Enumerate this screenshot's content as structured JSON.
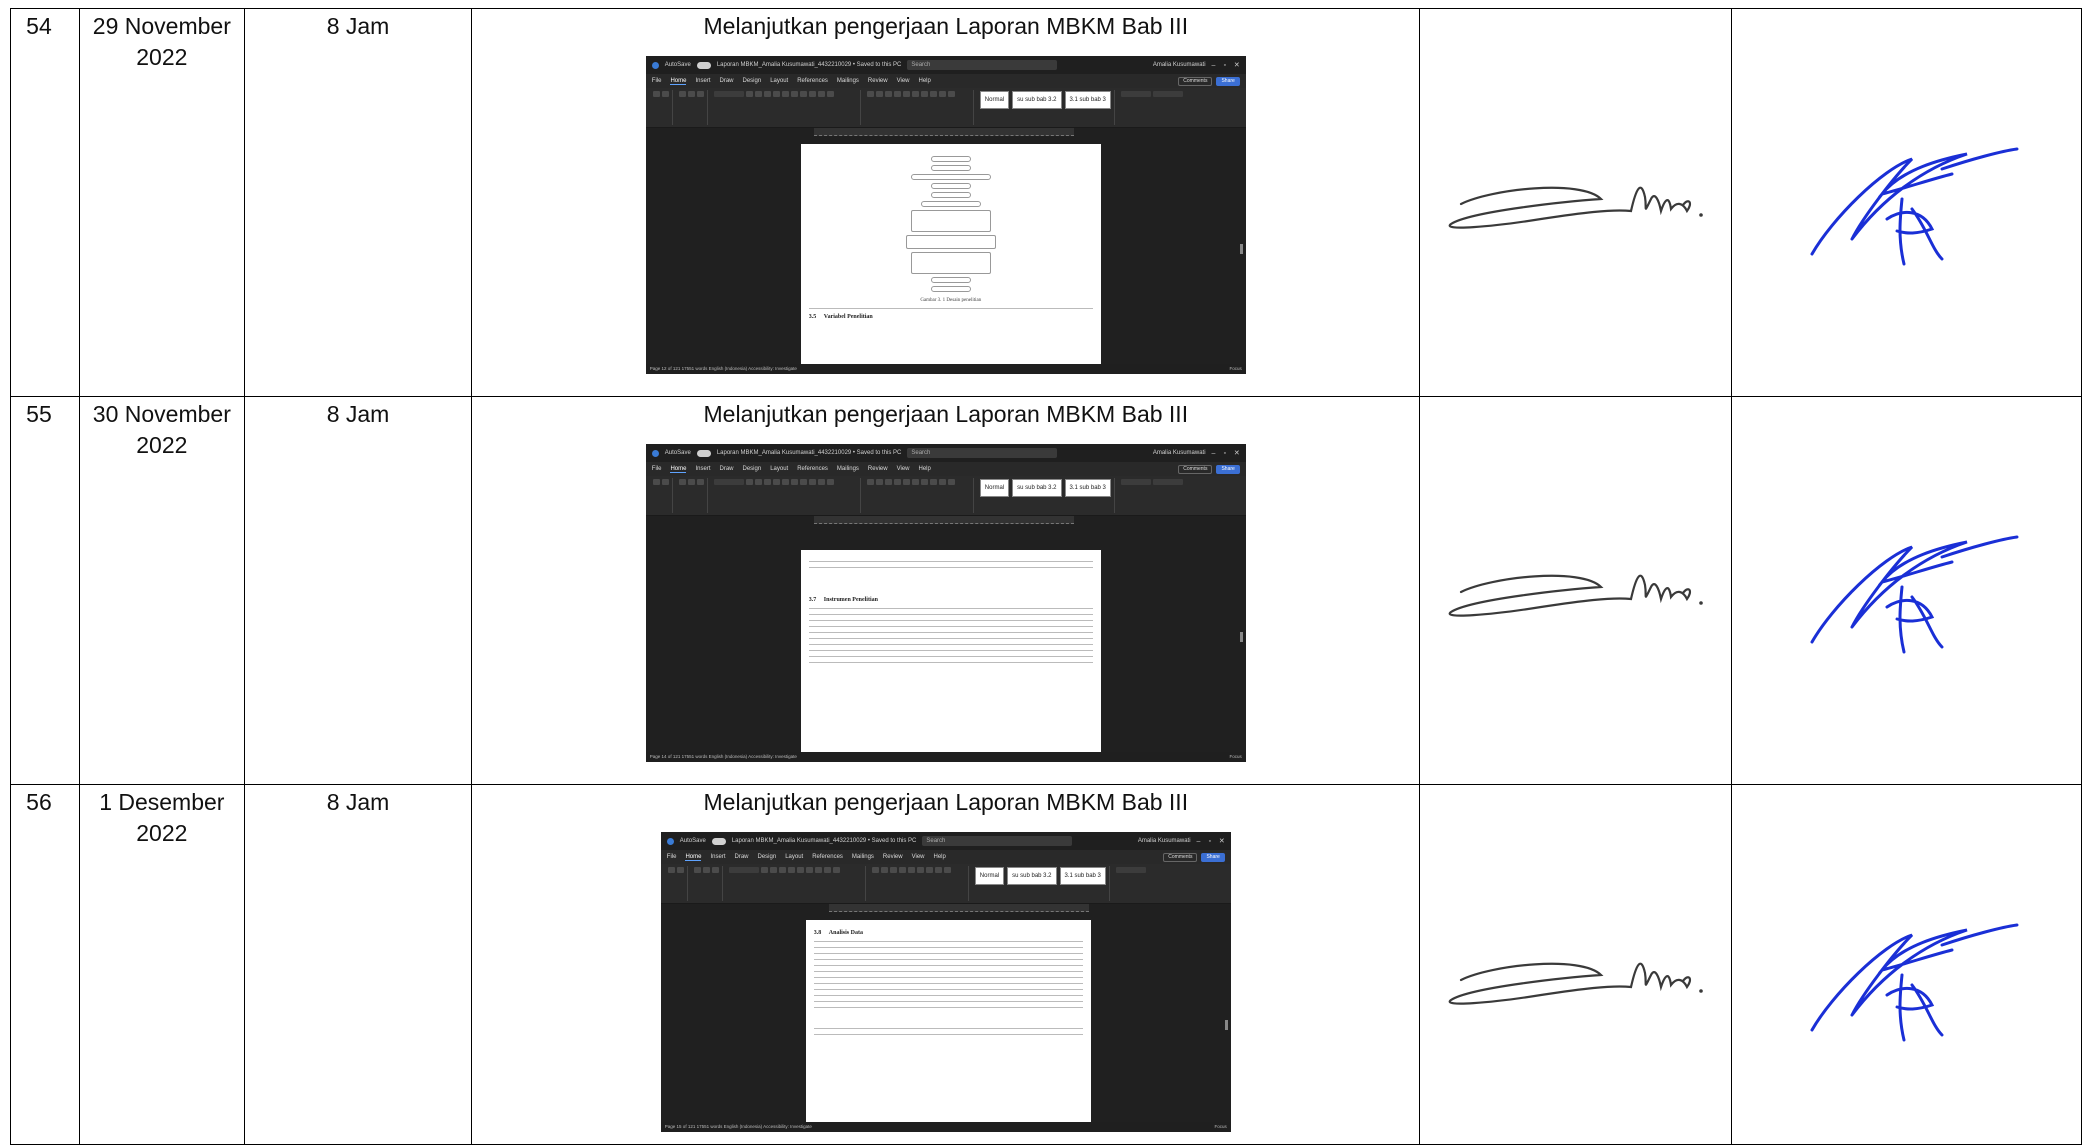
{
  "rows": [
    {
      "no": "54",
      "date": "29 November 2022",
      "duration": "8 Jam",
      "activity": "Melanjutkan pengerjaan Laporan MBKM Bab III",
      "screenshot": {
        "heading": "Variabel Penelitian",
        "section": "3.5",
        "caption": "Gambar 3. 1 Desain penelitian",
        "status": "Page 12 of 121   17551 words   English (Indonesia)   Accessibility: Investigate"
      }
    },
    {
      "no": "55",
      "date": "30 November 2022",
      "duration": "8 Jam",
      "activity": "Melanjutkan pengerjaan Laporan MBKM Bab III",
      "screenshot": {
        "heading": "Instrumen Penelitian",
        "section": "3.7",
        "caption": "",
        "status": "Page 14 of 121   17551 words   English (Indonesia)   Accessibility: Investigate"
      }
    },
    {
      "no": "56",
      "date": "1 Desember 2022",
      "duration": "8 Jam",
      "activity": "Melanjutkan pengerjaan Laporan MBKM Bab III",
      "screenshot": {
        "heading": "Analisis Data",
        "section": "3.8",
        "caption": "",
        "status": "Page 15 of 121   17551 words   English (Indonesia)   Accessibility: Investigate"
      }
    }
  ],
  "word_ui": {
    "autosave": "AutoSave",
    "doc_title": "Laporan MBKM_Amalia Kusumawati_4432210029 • Saved to this PC",
    "search": "Search",
    "user": "Amalia Kusumawati",
    "menu": [
      "File",
      "Home",
      "Insert",
      "Draw",
      "Design",
      "Layout",
      "References",
      "Mailings",
      "Review",
      "View",
      "Help"
    ],
    "comments": "Comments",
    "share": "Share",
    "styles": [
      "Normal",
      "su sub bab 3.2",
      "3.1 sub bab 3"
    ],
    "focus": "Focus"
  },
  "colors": {
    "ink_blue": "#1a2fd6",
    "ink_gray": "#3a3a3a",
    "word_dark": "#202020",
    "word_accent": "#3b6fd4"
  },
  "icons": [
    "word-logo-icon",
    "search-icon",
    "signature-student",
    "signature-lecturer"
  ]
}
